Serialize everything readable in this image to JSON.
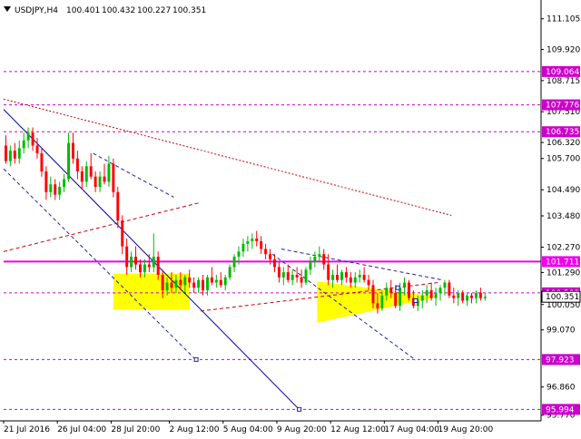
{
  "header": {
    "symbol": "USDJPY,H4",
    "open": "100.401",
    "high": "100.432",
    "low": "100.227",
    "close": "100.351"
  },
  "colors": {
    "bull": "#00bb00",
    "bear": "#ff0000",
    "level_line": "#cc00cc",
    "main_level": "#ee00ee",
    "trend_blue": "#0000aa",
    "dashed_blue": "#2020aa",
    "dashed_red": "#cc0000",
    "zone": "#ffff00",
    "triangle": "#ffff00",
    "axis": "#000000"
  },
  "chart_data": {
    "type": "candlestick",
    "symbol": "USDJPY",
    "timeframe": "H4",
    "y_range": [
      95.55,
      111.2
    ],
    "x_range": [
      0,
      120
    ],
    "y_ticks": [
      "111.105",
      "109.920",
      "108.715",
      "107.510",
      "106.320",
      "105.700",
      "104.490",
      "103.480",
      "102.270",
      "101.290",
      "100.050",
      "99.070",
      "96.860",
      "95.770"
    ],
    "x_ticks": [
      {
        "x": 0,
        "label": "21 Jul 2016"
      },
      {
        "x": 12,
        "label": "26 Jul 04:00"
      },
      {
        "x": 24,
        "label": "28 Jul 20:00"
      },
      {
        "x": 37,
        "label": "2 Aug 12:00"
      },
      {
        "x": 49,
        "label": "5 Aug 04:00"
      },
      {
        "x": 61,
        "label": "9 Aug 20:00"
      },
      {
        "x": 73,
        "label": "12 Aug 12:00"
      },
      {
        "x": 85,
        "label": "17 Aug 04:00"
      },
      {
        "x": 97,
        "label": "19 Aug 20:00"
      }
    ],
    "levels": [
      {
        "price": 109.064,
        "label": "109.064",
        "style": "dashed"
      },
      {
        "price": 107.776,
        "label": "107.776",
        "style": "dashed"
      },
      {
        "price": 106.735,
        "label": "106.735",
        "style": "dashed"
      },
      {
        "price": 101.711,
        "label": "101.711",
        "style": "solid"
      },
      {
        "price": 100.503,
        "label": "100.503",
        "style": "dashed"
      },
      {
        "price": 97.923,
        "label": "97.923",
        "style": "dashed"
      },
      {
        "price": 95.994,
        "label": "95.994",
        "style": "dashed"
      }
    ],
    "current_price": "100.351",
    "candles": [
      [
        106.2,
        106.6,
        105.5,
        105.6
      ],
      [
        105.6,
        106.2,
        105.4,
        106.0
      ],
      [
        106.0,
        106.3,
        105.5,
        105.7
      ],
      [
        105.7,
        106.4,
        105.5,
        106.1
      ],
      [
        106.1,
        106.7,
        105.9,
        106.4
      ],
      [
        106.4,
        106.9,
        106.1,
        106.7
      ],
      [
        106.7,
        106.9,
        106.0,
        106.2
      ],
      [
        106.2,
        106.5,
        105.7,
        105.9
      ],
      [
        105.9,
        106.1,
        105.0,
        105.2
      ],
      [
        105.2,
        105.4,
        104.1,
        104.4
      ],
      [
        104.4,
        105.0,
        104.2,
        104.7
      ],
      [
        104.7,
        104.9,
        104.1,
        104.3
      ],
      [
        104.3,
        104.8,
        104.1,
        104.6
      ],
      [
        104.6,
        105.1,
        104.4,
        104.9
      ],
      [
        104.9,
        106.7,
        104.8,
        106.3
      ],
      [
        106.3,
        106.7,
        105.5,
        105.7
      ],
      [
        105.7,
        106.0,
        104.9,
        105.2
      ],
      [
        105.2,
        105.4,
        104.5,
        104.8
      ],
      [
        104.8,
        105.6,
        104.6,
        105.4
      ],
      [
        105.4,
        105.9,
        104.9,
        105.0
      ],
      [
        105.0,
        105.2,
        104.4,
        104.6
      ],
      [
        104.6,
        105.2,
        104.4,
        105.0
      ],
      [
        105.0,
        105.5,
        104.7,
        104.8
      ],
      [
        104.8,
        105.8,
        104.6,
        105.5
      ],
      [
        105.5,
        105.7,
        104.2,
        104.4
      ],
      [
        104.4,
        104.6,
        103.0,
        103.3
      ],
      [
        103.3,
        103.5,
        102.0,
        102.3
      ],
      [
        102.3,
        102.6,
        101.2,
        101.5
      ],
      [
        101.5,
        102.1,
        101.3,
        101.9
      ],
      [
        101.9,
        102.3,
        101.4,
        101.6
      ],
      [
        101.6,
        101.8,
        101.1,
        101.3
      ],
      [
        101.3,
        101.8,
        101.1,
        101.6
      ],
      [
        101.6,
        102.0,
        101.3,
        101.5
      ],
      [
        101.5,
        102.8,
        101.3,
        101.9
      ],
      [
        101.9,
        102.1,
        101.0,
        101.2
      ],
      [
        101.2,
        101.4,
        100.3,
        100.6
      ],
      [
        100.6,
        101.1,
        100.4,
        100.9
      ],
      [
        100.9,
        101.3,
        100.5,
        100.7
      ],
      [
        100.7,
        101.2,
        100.5,
        101.0
      ],
      [
        101.0,
        101.3,
        100.6,
        100.8
      ],
      [
        100.8,
        101.2,
        100.5,
        101.1
      ],
      [
        101.1,
        101.4,
        100.7,
        100.9
      ],
      [
        100.9,
        101.1,
        100.5,
        100.7
      ],
      [
        100.7,
        101.1,
        100.5,
        101.0
      ],
      [
        101.0,
        101.2,
        100.4,
        100.6
      ],
      [
        100.6,
        101.2,
        100.4,
        101.1
      ],
      [
        101.1,
        101.5,
        100.8,
        100.9
      ],
      [
        100.9,
        101.2,
        100.7,
        101.0
      ],
      [
        101.0,
        101.3,
        100.7,
        100.8
      ],
      [
        100.8,
        101.2,
        100.6,
        101.1
      ],
      [
        101.1,
        101.6,
        101.0,
        101.5
      ],
      [
        101.5,
        102.0,
        101.3,
        101.9
      ],
      [
        101.9,
        102.3,
        101.6,
        102.1
      ],
      [
        102.1,
        102.6,
        101.9,
        102.4
      ],
      [
        102.4,
        102.7,
        102.1,
        102.5
      ],
      [
        102.5,
        102.8,
        102.2,
        102.6
      ],
      [
        102.6,
        102.9,
        102.3,
        102.5
      ],
      [
        102.5,
        102.7,
        102.0,
        102.2
      ],
      [
        102.2,
        102.4,
        101.8,
        102.0
      ],
      [
        102.0,
        102.2,
        101.6,
        101.8
      ],
      [
        101.8,
        102.0,
        101.3,
        101.5
      ],
      [
        101.5,
        101.7,
        100.9,
        101.1
      ],
      [
        101.1,
        101.5,
        100.8,
        101.3
      ],
      [
        101.3,
        101.6,
        100.9,
        101.0
      ],
      [
        101.0,
        101.4,
        100.8,
        101.2
      ],
      [
        101.2,
        101.5,
        100.9,
        101.1
      ],
      [
        101.1,
        101.4,
        100.7,
        100.9
      ],
      [
        100.9,
        101.5,
        100.8,
        101.4
      ],
      [
        101.4,
        101.9,
        101.2,
        101.7
      ],
      [
        101.7,
        102.1,
        101.5,
        101.9
      ],
      [
        101.9,
        102.3,
        101.7,
        102.0
      ],
      [
        102.0,
        102.2,
        101.4,
        101.6
      ],
      [
        101.6,
        102.0,
        100.8,
        101.0
      ],
      [
        101.0,
        101.4,
        100.7,
        101.2
      ],
      [
        101.2,
        101.6,
        100.9,
        101.0
      ],
      [
        101.0,
        101.4,
        100.8,
        101.3
      ],
      [
        101.3,
        101.5,
        100.9,
        101.1
      ],
      [
        101.1,
        101.3,
        100.7,
        100.9
      ],
      [
        100.9,
        101.3,
        100.7,
        101.1
      ],
      [
        101.1,
        101.4,
        100.9,
        101.2
      ],
      [
        101.2,
        101.5,
        100.9,
        101.0
      ],
      [
        101.0,
        101.2,
        100.6,
        100.8
      ],
      [
        100.8,
        101.0,
        99.9,
        100.1
      ],
      [
        100.1,
        100.5,
        99.7,
        99.9
      ],
      [
        99.9,
        100.6,
        99.8,
        100.4
      ],
      [
        100.4,
        100.9,
        100.2,
        100.7
      ],
      [
        100.7,
        101.0,
        100.3,
        100.5
      ],
      [
        100.5,
        100.8,
        99.9,
        100.0
      ],
      [
        100.0,
        100.9,
        99.8,
        100.7
      ],
      [
        100.7,
        101.1,
        100.4,
        100.9
      ],
      [
        100.9,
        101.0,
        100.2,
        100.3
      ],
      [
        100.3,
        100.6,
        99.9,
        100.0
      ],
      [
        100.0,
        100.4,
        99.8,
        100.2
      ],
      [
        100.2,
        100.6,
        99.9,
        100.4
      ],
      [
        100.4,
        100.8,
        100.1,
        100.6
      ],
      [
        100.6,
        100.9,
        100.2,
        100.3
      ],
      [
        100.3,
        100.7,
        100.0,
        100.5
      ],
      [
        100.5,
        100.8,
        100.2,
        100.7
      ],
      [
        100.7,
        101.0,
        100.4,
        100.9
      ],
      [
        100.9,
        101.0,
        100.3,
        100.4
      ],
      [
        100.4,
        100.7,
        100.1,
        100.3
      ],
      [
        100.3,
        100.6,
        100.0,
        100.5
      ],
      [
        100.5,
        100.6,
        100.1,
        100.2
      ],
      [
        100.2,
        100.5,
        100.0,
        100.4
      ],
      [
        100.4,
        100.5,
        100.1,
        100.3
      ],
      [
        100.3,
        100.6,
        100.1,
        100.5
      ],
      [
        100.5,
        100.7,
        100.2,
        100.3
      ],
      [
        100.3,
        100.5,
        100.2,
        100.35
      ]
    ],
    "zones": [
      {
        "x1": 24.5,
        "x2": 41.5,
        "y1": 101.25,
        "y2": 99.85,
        "note": "rectangle"
      }
    ],
    "triangle": [
      [
        70,
        100.95
      ],
      [
        97,
        100.35
      ],
      [
        70,
        99.35
      ]
    ],
    "trend_lines": [
      {
        "from": [
          0,
          107.6
        ],
        "to": [
          66,
          95.99
        ],
        "style": "solid"
      },
      {
        "from": [
          0,
          105.3
        ],
        "to": [
          43,
          97.9
        ],
        "style": "dashed"
      },
      {
        "from": [
          20,
          105.9
        ],
        "to": [
          38,
          104.2
        ],
        "style": "dashed"
      },
      {
        "from": [
          0,
          102.1
        ],
        "to": [
          44,
          104.0
        ],
        "style": "dashed"
      },
      {
        "from": [
          0,
          108.0
        ],
        "to": [
          100,
          103.5
        ],
        "style": "dotted"
      },
      {
        "from": [
          60,
          102.0
        ],
        "to": [
          92,
          97.9
        ],
        "style": "dashed"
      },
      {
        "from": [
          62,
          102.2
        ],
        "to": [
          98,
          101.0
        ],
        "style": "dashed"
      },
      {
        "from": [
          44,
          99.8
        ],
        "to": [
          97,
          100.9
        ],
        "style": "dashed"
      }
    ],
    "markers": [
      {
        "x": 43,
        "y": 97.923
      },
      {
        "x": 66,
        "y": 95.994
      },
      {
        "x": 92,
        "y": 100.2
      },
      {
        "x": 88,
        "y": 100.7
      }
    ]
  }
}
